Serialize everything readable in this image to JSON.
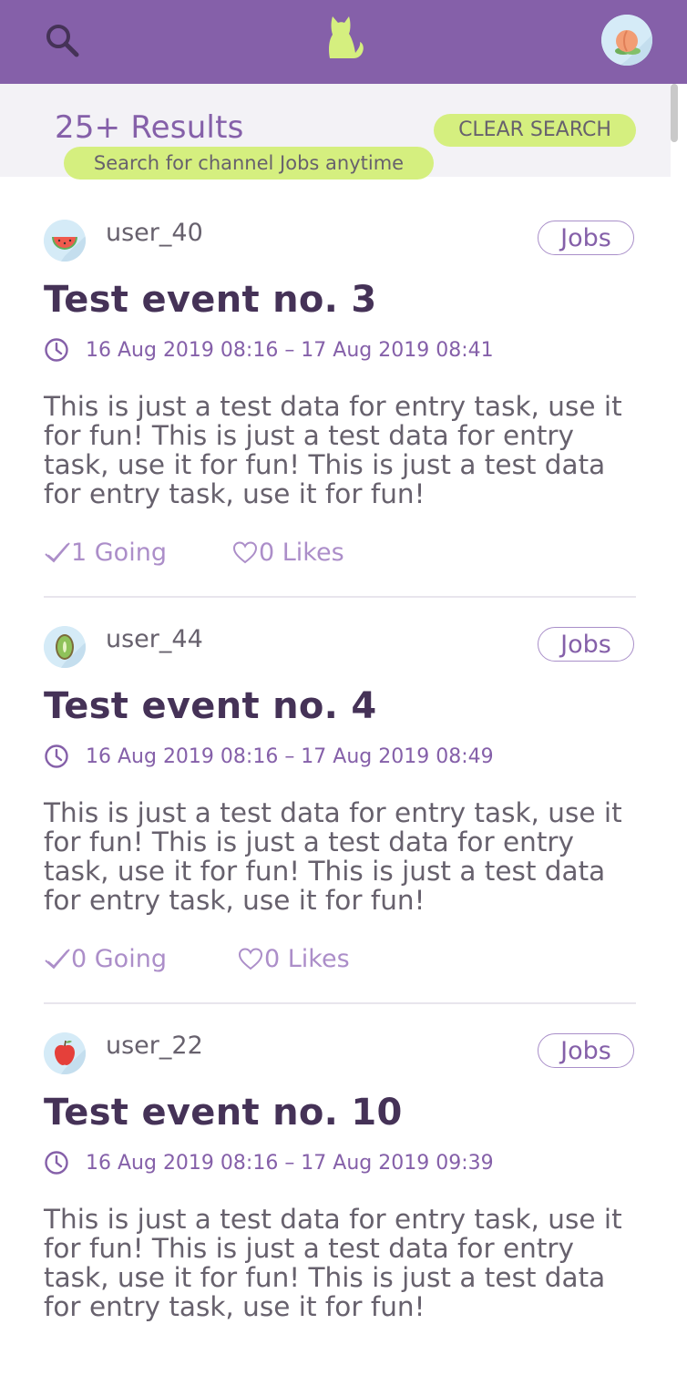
{
  "header": {
    "search_icon": "search-icon",
    "logo_icon": "cat-logo-icon",
    "avatar_icon": "peach-avatar-icon"
  },
  "results": {
    "count_label": "25+ Results",
    "clear_label": "CLEAR SEARCH",
    "description": "Search for channel Jobs anytime"
  },
  "events": [
    {
      "user": "user_40",
      "avatar": "watermelon",
      "channel": "Jobs",
      "title": "Test event no. 3",
      "time": "16 Aug 2019 08:16 – 17 Aug 2019 08:41",
      "description": "This is just a test data for entry task, use it for fun! This is just a test data for entry task, use it for fun! This is just a test data for entry task, use it for fun!",
      "going": "1 Going",
      "likes": "0 Likes"
    },
    {
      "user": "user_44",
      "avatar": "kiwi",
      "channel": "Jobs",
      "title": "Test event no. 4",
      "time": "16 Aug 2019 08:16 – 17 Aug 2019 08:49",
      "description": "This is just a test data for entry task, use it for fun! This is just a test data for entry task, use it for fun! This is just a test data for entry task, use it for fun!",
      "going": "0 Going",
      "likes": "0 Likes"
    },
    {
      "user": "user_22",
      "avatar": "apple",
      "channel": "Jobs",
      "title": "Test event no. 10",
      "time": "16 Aug 2019 08:16 – 17 Aug 2019 09:39",
      "description": "This is just a test data for entry task, use it for fun! This is just a test data for entry task, use it for fun! This is just a test data for entry task, use it for fun!",
      "going": "",
      "likes": ""
    }
  ],
  "colors": {
    "header_bg": "#8560a9",
    "accent_green": "#d5ef7f",
    "text_purple": "#8560a9",
    "title_dark": "#453257",
    "body_gray": "#67616d"
  }
}
